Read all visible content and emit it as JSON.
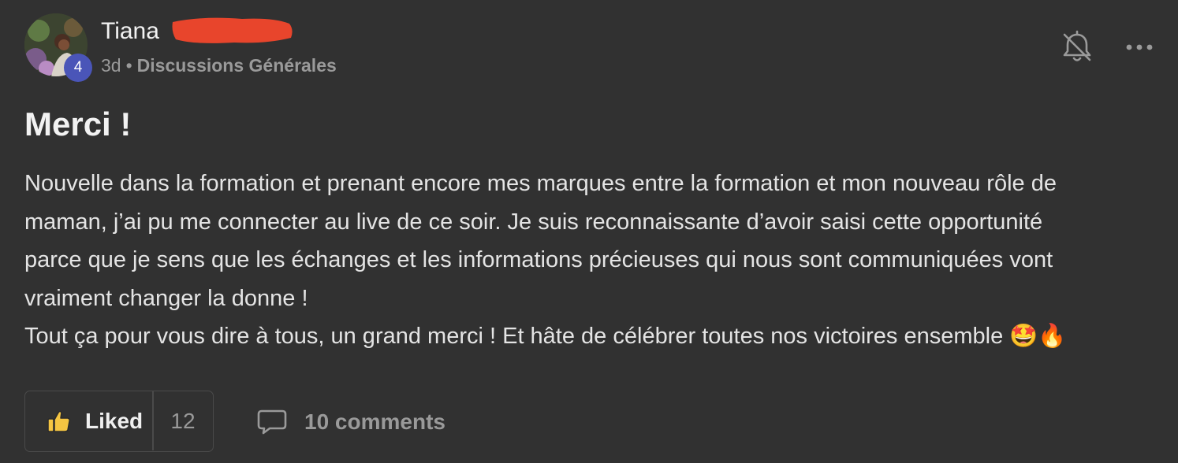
{
  "post": {
    "author": {
      "name": "Tiana",
      "level": "4"
    },
    "meta": {
      "time_ago": "3d",
      "separator": "•",
      "category": "Discussions Générales"
    },
    "title": "Merci !",
    "body_lines": [
      "Nouvelle dans la formation et prenant encore mes marques entre la formation et mon nouveau rôle de",
      "maman, j’ai pu me connecter au live de ce soir. Je suis reconnaissante d’avoir saisi cette opportunité",
      "parce que je sens que les échanges et les informations précieuses qui nous sont communiquées vont",
      "vraiment changer la donne !",
      "Tout ça pour vous dire à tous, un grand merci ! Et hâte de célébrer toutes nos victoires ensemble 🤩🔥"
    ],
    "actions": {
      "like_label": "Liked",
      "like_count": "12",
      "comments_label": "10 comments"
    },
    "icons": {
      "notifications": "bell-off-icon",
      "more": "more-horizontal-icon",
      "like": "thumbs-up-icon",
      "comments": "comment-bubble-icon"
    },
    "colors": {
      "background": "#313131",
      "level_badge": "#4a55b8",
      "redaction": "#e8452c",
      "thumb": "#f5c542"
    }
  }
}
